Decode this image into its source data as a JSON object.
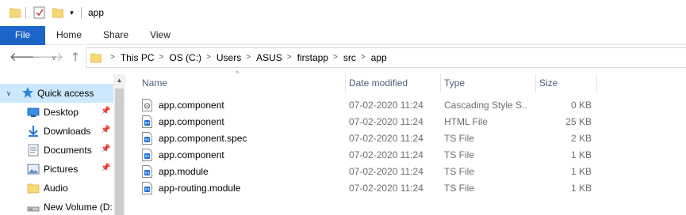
{
  "window": {
    "title": "app"
  },
  "ribbon": {
    "tabs": [
      "File",
      "Home",
      "Share",
      "View"
    ]
  },
  "navigation": {
    "back_icon": "arrow-left-icon",
    "forward_icon": "arrow-right-icon",
    "recent_icon": "chevron-down-icon",
    "up_icon": "arrow-up-icon"
  },
  "address": {
    "crumbs": [
      "This PC",
      "OS (C:)",
      "Users",
      "ASUS",
      "firstapp",
      "src",
      "app"
    ]
  },
  "sidebar": {
    "quick_access": "Quick access",
    "items": [
      {
        "label": "Desktop",
        "icon": "desktop-icon",
        "pinned": true
      },
      {
        "label": "Downloads",
        "icon": "downloads-icon",
        "pinned": true
      },
      {
        "label": "Documents",
        "icon": "documents-icon",
        "pinned": true
      },
      {
        "label": "Pictures",
        "icon": "pictures-icon",
        "pinned": true
      },
      {
        "label": "Audio",
        "icon": "folder-icon",
        "pinned": false
      },
      {
        "label": "New Volume (D:",
        "icon": "drive-icon",
        "pinned": false
      }
    ]
  },
  "filelist": {
    "columns": {
      "name": "Name",
      "date": "Date modified",
      "type": "Type",
      "size": "Size"
    },
    "rows": [
      {
        "name": "app.component",
        "date": "07-02-2020 11:24",
        "type": "Cascading Style S...",
        "size": "0 KB",
        "icon": "css-file-icon"
      },
      {
        "name": "app.component",
        "date": "07-02-2020 11:24",
        "type": "HTML File",
        "size": "25 KB",
        "icon": "html-file-icon"
      },
      {
        "name": "app.component.spec",
        "date": "07-02-2020 11:24",
        "type": "TS File",
        "size": "2 KB",
        "icon": "ts-file-icon"
      },
      {
        "name": "app.component",
        "date": "07-02-2020 11:24",
        "type": "TS File",
        "size": "1 KB",
        "icon": "ts-file-icon"
      },
      {
        "name": "app.module",
        "date": "07-02-2020 11:24",
        "type": "TS File",
        "size": "1 KB",
        "icon": "ts-file-icon"
      },
      {
        "name": "app-routing.module",
        "date": "07-02-2020 11:24",
        "type": "TS File",
        "size": "1 KB",
        "icon": "ts-file-icon"
      }
    ]
  },
  "colors": {
    "file_tab": "#1c64c8",
    "selection": "#cce8ff",
    "folder": "#f8d775",
    "header_text": "#4c607a"
  }
}
